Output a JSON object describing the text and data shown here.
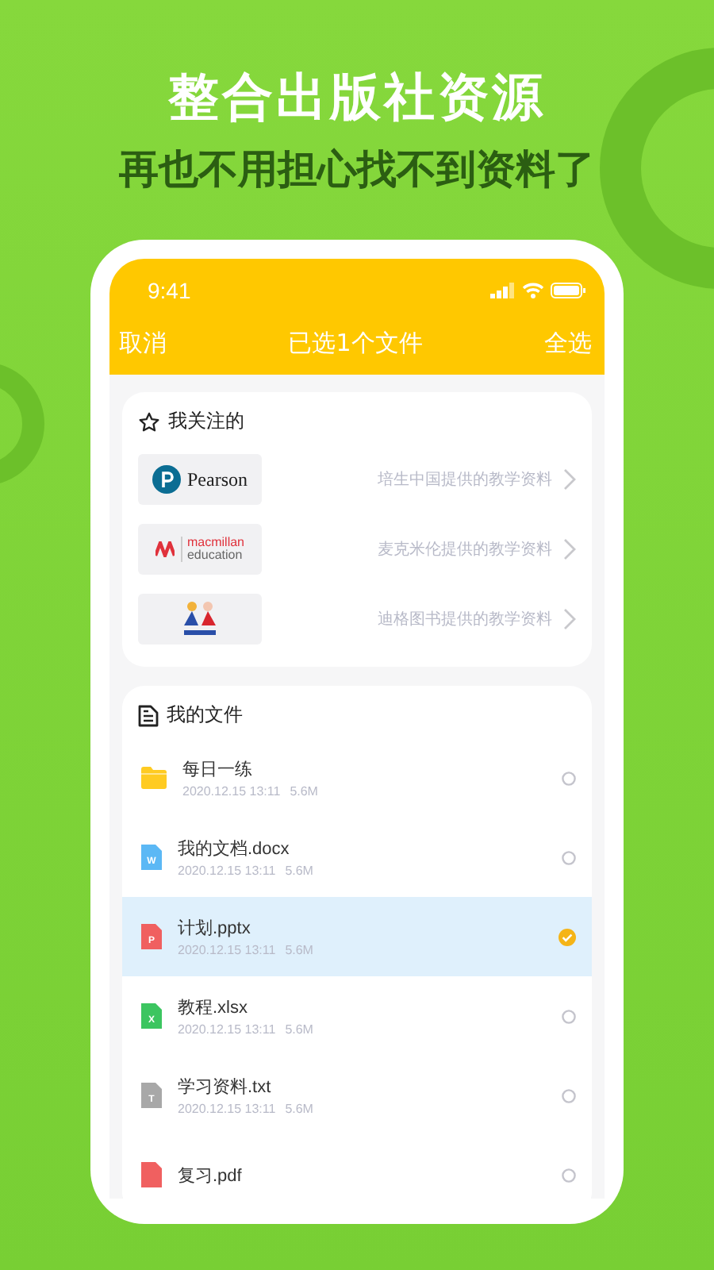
{
  "headline": "整合出版社资源",
  "subheadline": "再也不用担心找不到资料了",
  "status_bar": {
    "time": "9:41"
  },
  "nav": {
    "left": "取消",
    "title": "已选1个文件",
    "right": "全选"
  },
  "followed": {
    "title": "我关注的",
    "items": [
      {
        "kind": "pearson",
        "logo_text": [
          "Pearson"
        ],
        "desc": "培生中国提供的教学资料"
      },
      {
        "kind": "macmillan",
        "logo_text": [
          "macmillan",
          "education"
        ],
        "desc": "麦克米伦提供的教学资料"
      },
      {
        "kind": "dige",
        "desc": "迪格图书提供的教学资料"
      }
    ]
  },
  "files": {
    "title": "我的文件",
    "items": [
      {
        "kind": "folder",
        "name": "每日一练",
        "date": "2020.12.15 13:11",
        "size": "5.6M",
        "selected": false
      },
      {
        "kind": "word",
        "badge": "W",
        "name": "我的文档.docx",
        "date": "2020.12.15 13:11",
        "size": "5.6M",
        "selected": false
      },
      {
        "kind": "ppt",
        "badge": "P",
        "name": "计划.pptx",
        "date": "2020.12.15 13:11",
        "size": "5.6M",
        "selected": true
      },
      {
        "kind": "excel",
        "badge": "X",
        "name": "教程.xlsx",
        "date": "2020.12.15 13:11",
        "size": "5.6M",
        "selected": false
      },
      {
        "kind": "txt",
        "badge": "T",
        "name": "学习资料.txt",
        "date": "2020.12.15 13:11",
        "size": "5.6M",
        "selected": false
      },
      {
        "kind": "pdf",
        "name": "复习.pdf",
        "selected": false
      }
    ]
  }
}
